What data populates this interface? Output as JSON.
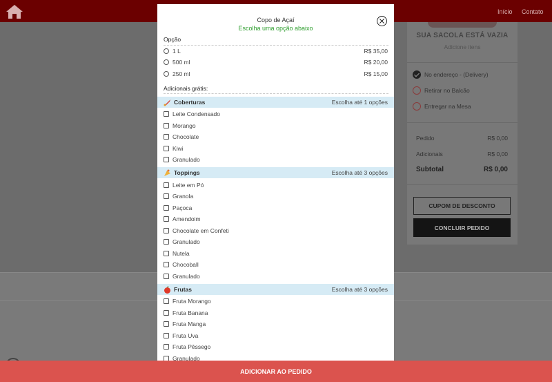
{
  "nav": {
    "inicio": "Início",
    "contato": "Contato"
  },
  "cart": {
    "bag_title": "SUA SACOLA ESTÁ VAZIA",
    "bag_subtitle": "Adicione itens",
    "delivery_options": [
      {
        "label": "No endereço - (Delivery)",
        "selected": true
      },
      {
        "label": "Retirar no Balcão",
        "selected": false
      },
      {
        "label": "Entregar na Mesa",
        "selected": false
      }
    ],
    "summary": {
      "pedido_label": "Pedido",
      "pedido_value": "R$ 0,00",
      "adicionais_label": "Adicionais",
      "adicionais_value": "R$ 0,00",
      "subtotal_label": "Subtotal",
      "subtotal_value": "R$ 0,00"
    },
    "coupon_label": "CUPOM DE DESCONTO",
    "finish_label": "CONCLUIR PEDIDO"
  },
  "modal": {
    "title": "Copo de Açaí",
    "subtitle": "Escolha uma opção abaixo",
    "options_heading": "Opção",
    "options": [
      {
        "label": "1 L",
        "price": "R$ 35,00"
      },
      {
        "label": "500 ml",
        "price": "R$ 20,00"
      },
      {
        "label": "250 ml",
        "price": "R$ 15,00"
      }
    ],
    "extras_heading": "Adicionais grátis:",
    "categories": [
      {
        "name": "Coberturas",
        "limit": "Escolha até 1 opções",
        "icon": "syrup-icon",
        "items": [
          "Leite Condensado",
          "Morango",
          "Chocolate",
          "Kiwi",
          "Granulado"
        ]
      },
      {
        "name": "Toppings",
        "limit": "Escolha até 3 opções",
        "icon": "topping-icon",
        "items": [
          "Leite em Pó",
          "Granola",
          "Paçoca",
          "Amendoim",
          "Chocolate em Confeti",
          "Granulado",
          "Nutela",
          "Chocoball",
          "Granulado"
        ]
      },
      {
        "name": "Frutas",
        "limit": "Escolha até 3 opções",
        "icon": "fruit-icon",
        "items": [
          "Fruta Morango",
          "Fruta Banana",
          "Fruta Manga",
          "Fruta Uva",
          "Fruta Pêssego",
          "Granulado"
        ]
      }
    ]
  },
  "add_button_label": "ADICIONAR AO PEDIDO",
  "colors": {
    "topbar": "#6b0000",
    "add_button": "#db534e",
    "subtitle_green": "#2e9e2e",
    "category_bar": "#d6ebf5"
  }
}
